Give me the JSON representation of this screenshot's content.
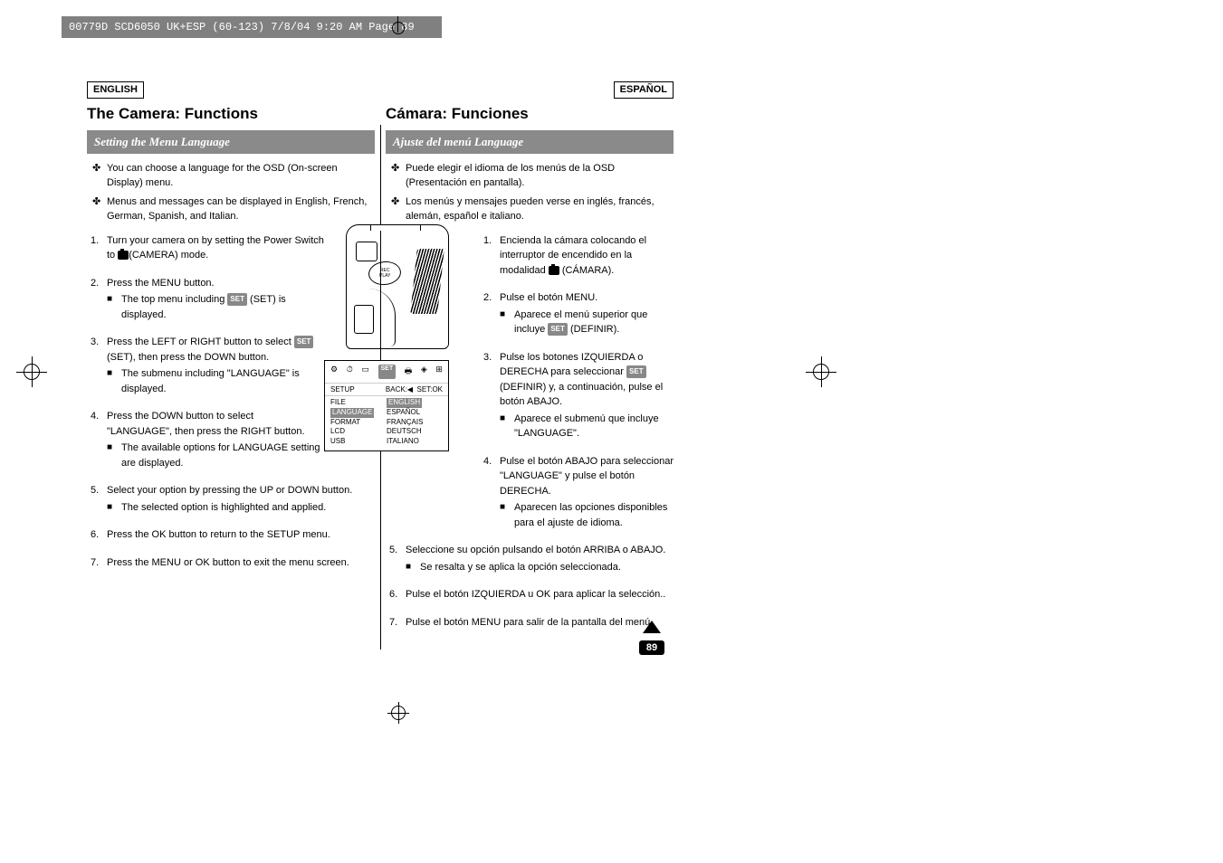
{
  "header": "00779D SCD6050 UK+ESP (60-123)  7/8/04 9:20 AM  Page 89",
  "left": {
    "langTag": "ENGLISH",
    "title": "The Camera: Functions",
    "subsection": "Setting the Menu Language",
    "intro1": "You can choose a language for the OSD (On-screen Display) menu.",
    "intro2": "Menus and messages can be displayed in English, French, German, Spanish, and Italian.",
    "s1": "Turn your camera on by setting the Power Switch to",
    "s1b": "(CAMERA) mode.",
    "s2": "Press the MENU button.",
    "s2a": "The top menu including",
    "s2a2": "(SET) is displayed.",
    "s3": "Press the LEFT or RIGHT button to select",
    "s3b": "(SET), then press the DOWN button.",
    "s3a": "The submenu including \"LANGUAGE\" is displayed.",
    "s4": "Press the DOWN button to select \"LANGUAGE\", then press the RIGHT button.",
    "s4a": "The available options for LANGUAGE setting are displayed.",
    "s5": "Select your option by pressing the UP or DOWN button.",
    "s5a": "The selected option is highlighted and applied.",
    "s6": "Press the OK button to return to the SETUP menu.",
    "s7": "Press the MENU or OK button to exit the menu screen."
  },
  "right": {
    "langTag": "ESPAÑOL",
    "title": "Cámara: Funciones",
    "subsection": "Ajuste del menú Language",
    "intro1": "Puede elegir el idioma de los menús de la OSD (Presentación en pantalla).",
    "intro2": "Los menús y mensajes pueden verse en inglés, francés, alemán, español e italiano.",
    "s1": "Encienda la cámara colocando el interruptor de encendido en la modalidad",
    "s1b": "(CÁMARA).",
    "s2": "Pulse el botón MENU.",
    "s2a": "Aparece el menú superior que incluye",
    "s2a2": "(DEFINIR).",
    "s3": "Pulse los botones IZQUIERDA o DERECHA para seleccionar",
    "s3b": "(DEFINIR) y, a continuación, pulse el botón ABAJO.",
    "s3a": "Aparece el submenú que incluye \"LANGUAGE\".",
    "s4": "Pulse el botón ABAJO para seleccionar \"LANGUAGE\" y pulse el botón DERECHA.",
    "s4a": "Aparecen las opciones disponibles para el ajuste de idioma.",
    "s5": "Seleccione su opción pulsando el botón ARRIBA o ABAJO.",
    "s5a": "Se resalta y se aplica la opción seleccionada.",
    "s6": "Pulse el botón IZQUIERDA u OK para aplicar la selección..",
    "s7": "Pulse el botón MENU para salir de la pantalla del menú."
  },
  "menu": {
    "setBadge": "SET",
    "title": "SETUP",
    "back": "BACK:◀",
    "setok": "SET:OK",
    "leftCol": [
      "FILE",
      "LANGUAGE",
      "FORMAT",
      "LCD",
      "USB"
    ],
    "rightCol": [
      "ENGLISH",
      "ESPAÑOL",
      "FRANÇAIS",
      "DEUTSCH",
      "ITALIANO"
    ]
  },
  "pageNumber": "89"
}
